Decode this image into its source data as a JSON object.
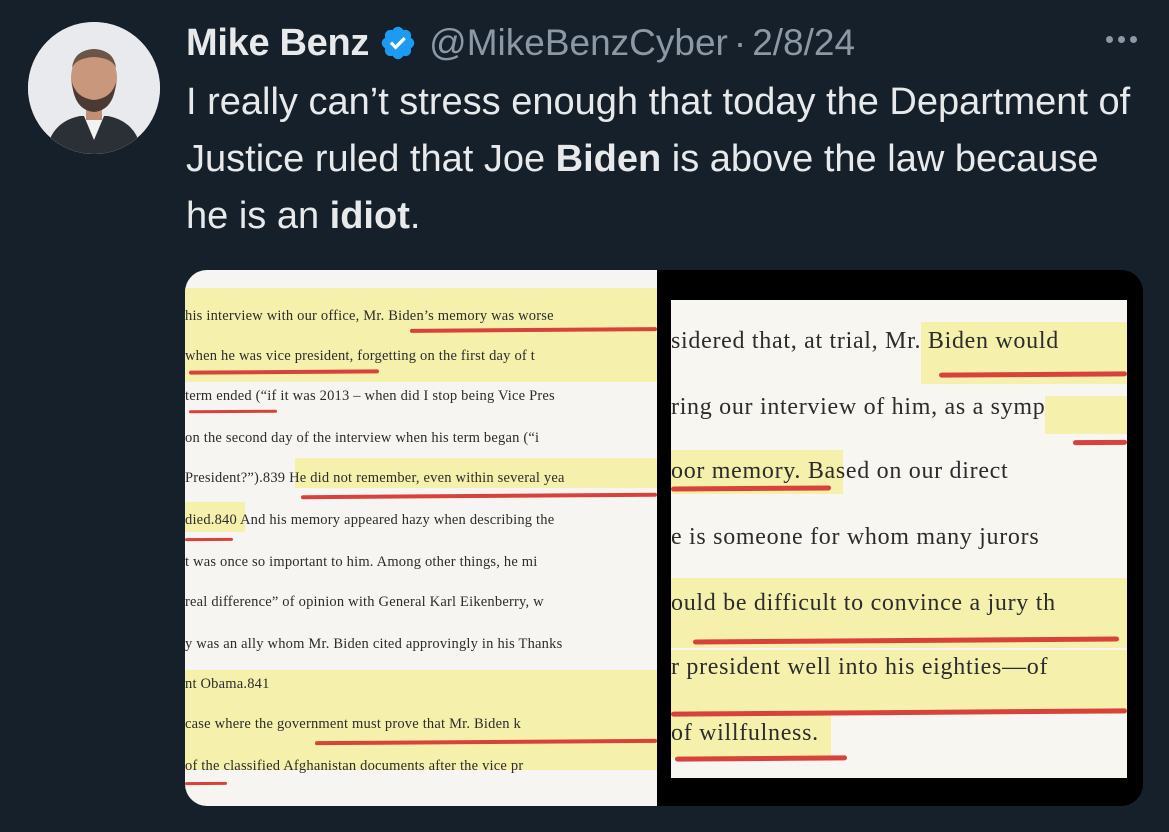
{
  "author": {
    "name": "Mike Benz",
    "handle": "@MikeBenzCyber",
    "separator": "·",
    "date": "2/8/24",
    "verified_icon": "verified-badge-icon",
    "avatar_icon": "profile-photo"
  },
  "tweet": {
    "text_part1": "I really can’t stress enough that today the Department of Justice ruled that Joe ",
    "bold1": "Biden",
    "text_part2": " is above the law because he is an ",
    "bold2": "idiot",
    "text_part3": "."
  },
  "more_icon": "more-options-icon",
  "colors": {
    "background": "#16202b",
    "text": "#e7e9ea",
    "secondary": "#8b98a5",
    "verified": "#1d9bf0",
    "highlight": "#f4f0a0",
    "underline": "#d9423a"
  },
  "media": {
    "left_page": [
      "his interview with our office, Mr. Biden’s memory was worse",
      " when he was vice president, forgetting on the first day of t",
      "term ended (“if it was 2013 – when did I stop being Vice Pres",
      " on the second day of the interview when his term began (“i",
      "President?”).839 He did not remember, even within several yea",
      "died.840 And his memory appeared hazy when describing the",
      "t was once so important to him. Among other things, he mi",
      " real difference” of opinion with General Karl Eikenberry, w",
      "y was an ally whom Mr. Biden cited approvingly in his Thanks",
      "nt Obama.841",
      " case where the government must prove that Mr. Biden k",
      " of the classified Afghanistan documents after the vice pr"
    ],
    "right_page": [
      "sidered that, at trial, Mr. Biden would",
      "ring our interview of him, as a symp",
      "oor memory. Based on our direct",
      "e is someone for whom many jurors",
      "ould be difficult to convince a jury th",
      "r president well into his eighties—of",
      "of willfulness."
    ]
  }
}
